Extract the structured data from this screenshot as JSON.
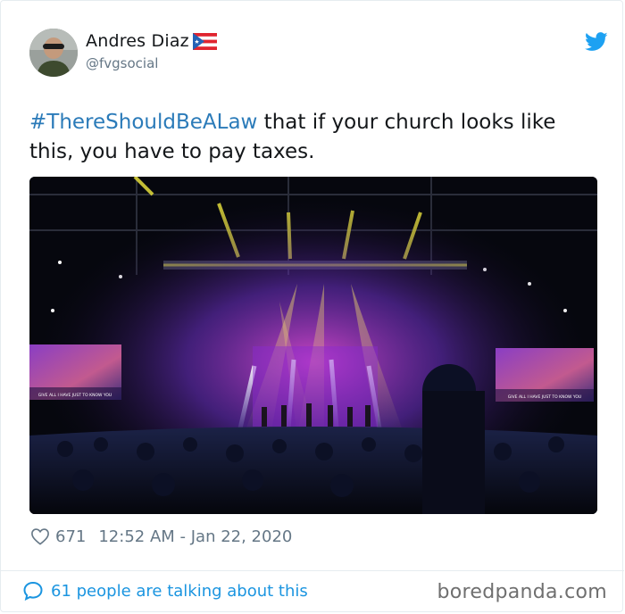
{
  "user": {
    "display_name": "Andres Diaz",
    "handle": "@fvgsocial",
    "avatar_icon": "avatar-photo",
    "flag_icon": "puerto-rico-flag-icon"
  },
  "tweet": {
    "hashtag": "#ThereShouldBeALaw",
    "text": " that if your church looks like this, you have to pay taxes."
  },
  "photo": {
    "screen_caption_left": "GIVE ALL I HAVE JUST TO KNOW YOU",
    "screen_caption_right": "GIVE ALL I HAVE JUST TO KNOW YOU"
  },
  "meta": {
    "likes": "671",
    "timestamp": "12:52 AM - Jan 22, 2020"
  },
  "footer": {
    "talking_text": "61 people are talking about this",
    "watermark": "boredpanda.com"
  },
  "colors": {
    "link_blue": "#1b95e0",
    "hashtag_blue": "#2b7bb9",
    "muted_gray": "#657786",
    "twitter_blue": "#1da1f2"
  }
}
